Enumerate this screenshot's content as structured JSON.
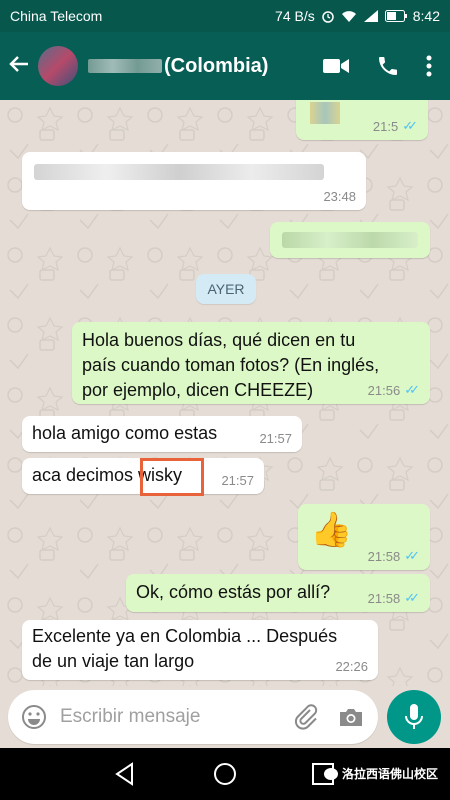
{
  "status_bar": {
    "carrier": "China Telecom",
    "speed": "74 B/s",
    "time": "8:42"
  },
  "header": {
    "contact_suffix": "(Colombia)"
  },
  "chat": {
    "date_chip": "AYER",
    "messages": [
      {
        "id": "m1",
        "dir": "out",
        "time": "21:5",
        "ticks": "✓✓",
        "redacted": true
      },
      {
        "id": "m2",
        "dir": "in",
        "time": "23:48",
        "redacted": true
      },
      {
        "id": "m3",
        "dir": "out",
        "time": "",
        "redacted": true
      },
      {
        "id": "m4",
        "dir": "out",
        "text_lines": [
          "Hola buenos días, qué dicen en tu",
          "país cuando toman fotos? (En inglés,",
          "por ejemplo, dicen CHEEZE)"
        ],
        "time": "21:56",
        "ticks": "✓✓"
      },
      {
        "id": "m5",
        "dir": "in",
        "text": "hola amigo como estas",
        "time": "21:57"
      },
      {
        "id": "m6",
        "dir": "in",
        "text": "aca decimos wisky",
        "time": "21:57"
      },
      {
        "id": "m7",
        "dir": "out",
        "emoji": "👍",
        "time": "21:58",
        "ticks": "✓✓"
      },
      {
        "id": "m8",
        "dir": "out",
        "text": "Ok, cómo estás por allí?",
        "time": "21:58",
        "ticks": "✓✓"
      },
      {
        "id": "m9",
        "dir": "in",
        "text_lines": [
          "Excelente ya en Colombia ... Después",
          "de un viaje tan largo"
        ],
        "time": "22:26"
      }
    ]
  },
  "composer": {
    "placeholder": "Escribir mensaje"
  },
  "watermark": {
    "text": "洛拉西语佛山校区"
  },
  "colors": {
    "appbar": "#075e54",
    "outgoing": "#dcf8c6",
    "incoming": "#ffffff",
    "fab": "#009688",
    "highlight": "#e8633a"
  }
}
